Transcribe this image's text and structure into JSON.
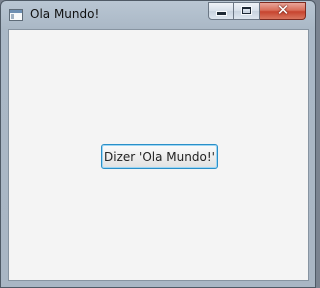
{
  "window": {
    "title": "Ola Mundo!",
    "icon": "app-window-icon"
  },
  "controls": {
    "minimize_icon": "minimize-icon",
    "maximize_icon": "maximize-icon",
    "close_icon": "close-icon",
    "close_glyph": "✕"
  },
  "content": {
    "button_label": "Dizer 'Ola Mundo!'"
  },
  "colors": {
    "close_button": "#c7442f",
    "button_focus_border": "#2a8fc8",
    "content_background": "#f4f4f4"
  }
}
